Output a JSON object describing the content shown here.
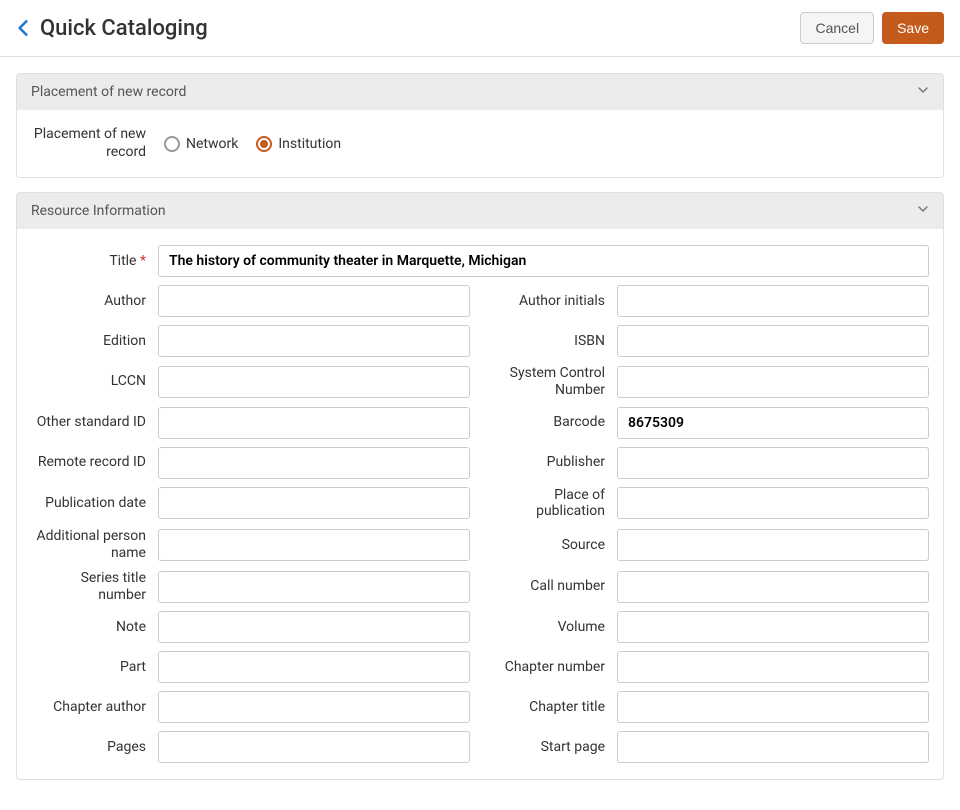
{
  "header": {
    "title": "Quick Cataloging",
    "cancel_label": "Cancel",
    "save_label": "Save"
  },
  "sections": {
    "placement": {
      "title": "Placement of new record",
      "label": "Placement of new record",
      "options": {
        "network": "Network",
        "institution": "Institution"
      },
      "selected": "institution"
    },
    "resource": {
      "title": "Resource Information",
      "fields": {
        "title": {
          "label": "Title",
          "value": "The history of community theater in Marquette, Michigan"
        },
        "author": {
          "label": "Author",
          "value": ""
        },
        "author_initials": {
          "label": "Author initials",
          "value": ""
        },
        "edition": {
          "label": "Edition",
          "value": ""
        },
        "isbn": {
          "label": "ISBN",
          "value": ""
        },
        "lccn": {
          "label": "LCCN",
          "value": ""
        },
        "system_control_number": {
          "label": "System Control Number",
          "value": ""
        },
        "other_standard_id": {
          "label": "Other standard ID",
          "value": ""
        },
        "barcode": {
          "label": "Barcode",
          "value": "8675309"
        },
        "remote_record_id": {
          "label": "Remote record ID",
          "value": ""
        },
        "publisher": {
          "label": "Publisher",
          "value": ""
        },
        "publication_date": {
          "label": "Publication date",
          "value": ""
        },
        "place_of_publication": {
          "label": "Place of publication",
          "value": ""
        },
        "additional_person_name": {
          "label": "Additional person name",
          "value": ""
        },
        "source": {
          "label": "Source",
          "value": ""
        },
        "series_title_number": {
          "label": "Series title number",
          "value": ""
        },
        "call_number": {
          "label": "Call number",
          "value": ""
        },
        "note": {
          "label": "Note",
          "value": ""
        },
        "volume": {
          "label": "Volume",
          "value": ""
        },
        "part": {
          "label": "Part",
          "value": ""
        },
        "chapter_number": {
          "label": "Chapter number",
          "value": ""
        },
        "chapter_author": {
          "label": "Chapter author",
          "value": ""
        },
        "chapter_title": {
          "label": "Chapter title",
          "value": ""
        },
        "pages": {
          "label": "Pages",
          "value": ""
        },
        "start_page": {
          "label": "Start page",
          "value": ""
        }
      }
    }
  }
}
